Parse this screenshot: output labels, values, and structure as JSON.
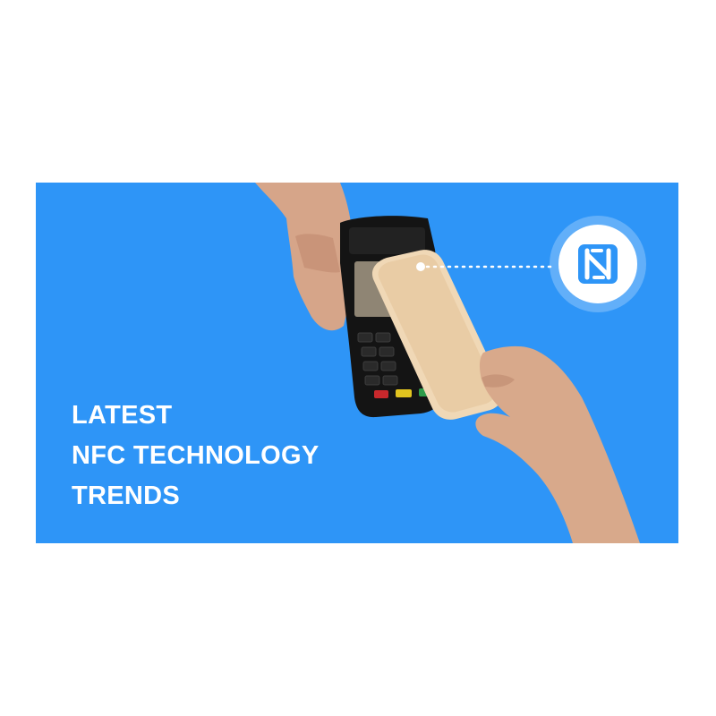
{
  "banner": {
    "background_color": "#2e95f7",
    "title_lines": [
      "LATEST",
      "NFC TECHNOLOGY",
      "TRENDS"
    ],
    "title_color": "#ffffff",
    "nfc_badge": {
      "icon": "nfc-logo-icon",
      "color": "#2e95f7"
    }
  }
}
